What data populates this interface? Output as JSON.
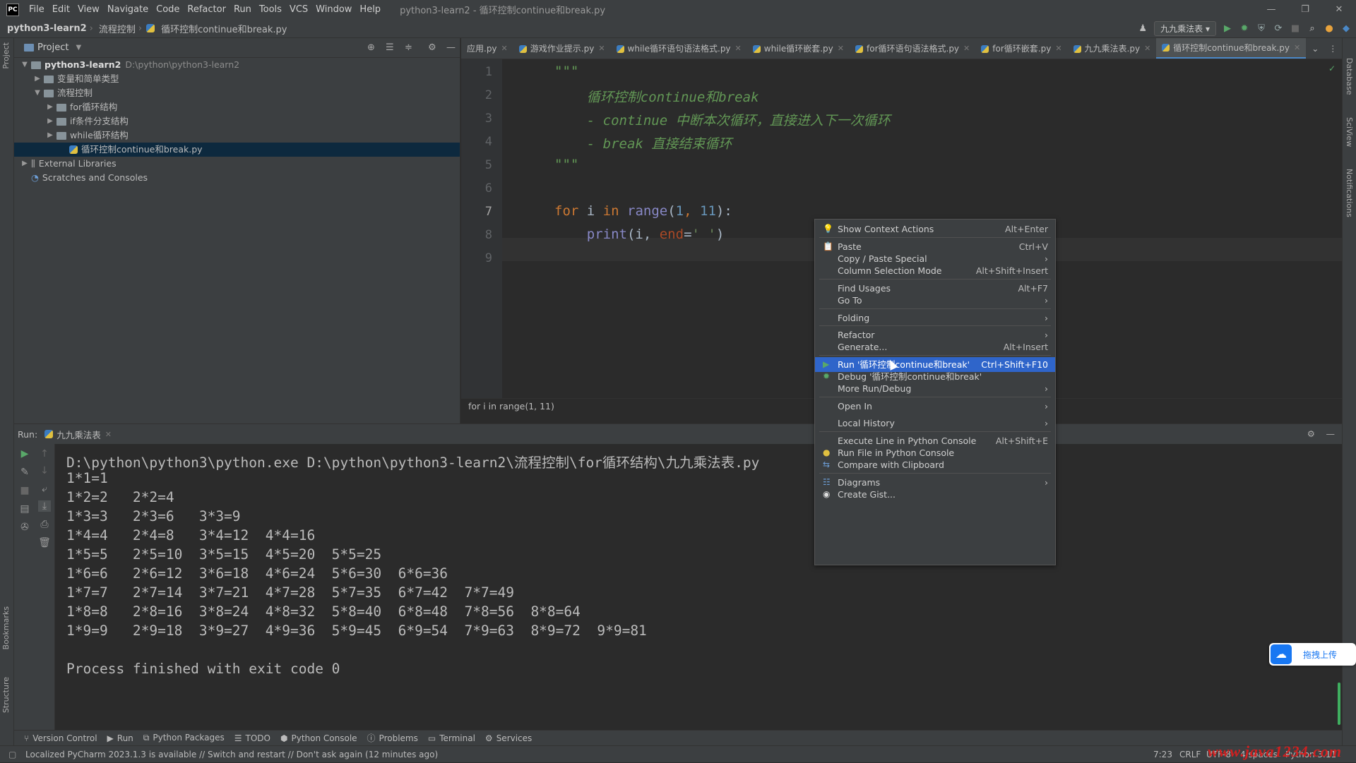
{
  "titlebar": {
    "logo": "PC",
    "menu": [
      "File",
      "Edit",
      "View",
      "Navigate",
      "Code",
      "Refactor",
      "Run",
      "Tools",
      "VCS",
      "Window",
      "Help"
    ],
    "title": "python3-learn2 - 循环控制continue和break.py",
    "controls": [
      "—",
      "❐",
      "✕"
    ]
  },
  "navbar": {
    "project": "python3-learn2",
    "folder": "流程控制",
    "file": "循环控制continue和break.py",
    "run_config": "九九乘法表"
  },
  "left_strip": {
    "top": "Project",
    "bottom1": "Bookmarks",
    "bottom2": "Structure"
  },
  "right_strip": {
    "a": "Database",
    "b": "SciView",
    "c": "Notifications"
  },
  "project_panel": {
    "title": "Project",
    "tree": [
      {
        "label": "python3-learn2",
        "hint": "D:\\python\\python3-learn2",
        "indent": 0,
        "type": "folder",
        "open": true,
        "bold": true
      },
      {
        "label": "变量和简单类型",
        "indent": 1,
        "type": "folder",
        "open": false
      },
      {
        "label": "流程控制",
        "indent": 1,
        "type": "folder",
        "open": true
      },
      {
        "label": "for循环结构",
        "indent": 2,
        "type": "folder",
        "open": false
      },
      {
        "label": "if条件分支结构",
        "indent": 2,
        "type": "folder",
        "open": false
      },
      {
        "label": "while循环结构",
        "indent": 2,
        "type": "folder",
        "open": false
      },
      {
        "label": "循环控制continue和break.py",
        "indent": 3,
        "type": "py",
        "selected": true
      },
      {
        "label": "External Libraries",
        "indent": 0,
        "type": "lib",
        "open": false
      },
      {
        "label": "Scratches and Consoles",
        "indent": 0,
        "type": "scratch"
      }
    ]
  },
  "editor": {
    "tabs": [
      {
        "label": "应用.py",
        "active": false
      },
      {
        "label": "游戏作业提示.py",
        "active": false
      },
      {
        "label": "while循环语句语法格式.py",
        "active": false
      },
      {
        "label": "while循环嵌套.py",
        "active": false
      },
      {
        "label": "for循环语句语法格式.py",
        "active": false
      },
      {
        "label": "for循环嵌套.py",
        "active": false
      },
      {
        "label": "九九乘法表.py",
        "active": false
      },
      {
        "label": "循环控制continue和break.py",
        "active": true
      }
    ],
    "line_numbers": [
      "1",
      "2",
      "3",
      "4",
      "5",
      "6",
      "7",
      "8",
      "9"
    ],
    "code": {
      "l1": "\"\"\"",
      "l2": "    循环控制continue和break",
      "l3": "    - continue 中断本次循环，直接进入下一次循环",
      "l4": "    - break 直接结束循环",
      "l5": "\"\"\"",
      "l7a": "for",
      "l7b": " i ",
      "l7c": "in",
      "l7d": " ",
      "l7e": "range",
      "l7f": "(",
      "l7g": "1",
      "l7h": ", ",
      "l7i": "11",
      "l7j": "):",
      "l8a": "    ",
      "l8b": "print",
      "l8c": "(i, ",
      "l8d": "end",
      "l8e": "=",
      "l8f": "' '",
      "l8g": ")"
    },
    "breadcrumb": "for i in range(1, 11)"
  },
  "context_menu": {
    "items": [
      {
        "label": "Show Context Actions",
        "shortcut": "Alt+Enter",
        "icon": "bulb-icon"
      },
      {
        "label": "Paste",
        "shortcut": "Ctrl+V",
        "icon": "clipboard-icon"
      },
      {
        "label": "Copy / Paste Special",
        "submenu": true
      },
      {
        "label": "Column Selection Mode",
        "shortcut": "Alt+Shift+Insert"
      },
      {
        "label": "Find Usages",
        "shortcut": "Alt+F7"
      },
      {
        "label": "Go To",
        "submenu": true
      },
      {
        "label": "Folding",
        "submenu": true
      },
      {
        "label": "Refactor",
        "submenu": true
      },
      {
        "label": "Generate...",
        "shortcut": "Alt+Insert"
      },
      {
        "label": "Run '循环控制continue和break'",
        "shortcut": "Ctrl+Shift+F10",
        "icon": "run-icon",
        "highlighted": true
      },
      {
        "label": "Debug '循环控制continue和break'",
        "icon": "debug-icon"
      },
      {
        "label": "More Run/Debug",
        "submenu": true
      },
      {
        "label": "Open In",
        "submenu": true
      },
      {
        "label": "Local History",
        "submenu": true
      },
      {
        "label": "Execute Line in Python Console",
        "shortcut": "Alt+Shift+E"
      },
      {
        "label": "Run File in Python Console",
        "icon": "python-icon"
      },
      {
        "label": "Compare with Clipboard",
        "icon": "compare-icon"
      },
      {
        "label": "Diagrams",
        "submenu": true,
        "icon": "diagram-icon"
      },
      {
        "label": "Create Gist...",
        "icon": "github-icon"
      }
    ]
  },
  "run_panel": {
    "label": "Run:",
    "tab": "九九乘法表",
    "output": [
      "D:\\python\\python3\\python.exe D:\\python\\python3-learn2\\流程控制\\for循环结构\\九九乘法表.py",
      "1*1=1",
      "1*2=2   2*2=4",
      "1*3=3   2*3=6   3*3=9",
      "1*4=4   2*4=8   3*4=12  4*4=16",
      "1*5=5   2*5=10  3*5=15  4*5=20  5*5=25",
      "1*6=6   2*6=12  3*6=18  4*6=24  5*6=30  6*6=36",
      "1*7=7   2*7=14  3*7=21  4*7=28  5*7=35  6*7=42  7*7=49",
      "1*8=8   2*8=16  3*8=24  4*8=32  5*8=40  6*8=48  7*8=56  8*8=64",
      "1*9=9   2*9=18  3*9=27  4*9=36  5*9=45  6*9=54  7*9=63  8*9=72  9*9=81",
      "",
      "Process finished with exit code 0"
    ]
  },
  "tool_windows": [
    "Version Control",
    "Run",
    "Python Packages",
    "TODO",
    "Python Console",
    "Problems",
    "Terminal",
    "Services"
  ],
  "statusbar": {
    "message": "Localized PyCharm 2023.1.3 is available // Switch and restart // Don't ask again (12 minutes ago)",
    "position": "7:23",
    "line_sep": "CRLF",
    "encoding": "UTF-8",
    "indent": "4 spaces",
    "interpreter": "Python 3.11",
    "watermark": "www.java1234.com"
  },
  "upload_widget": {
    "label": "拖拽上传"
  }
}
